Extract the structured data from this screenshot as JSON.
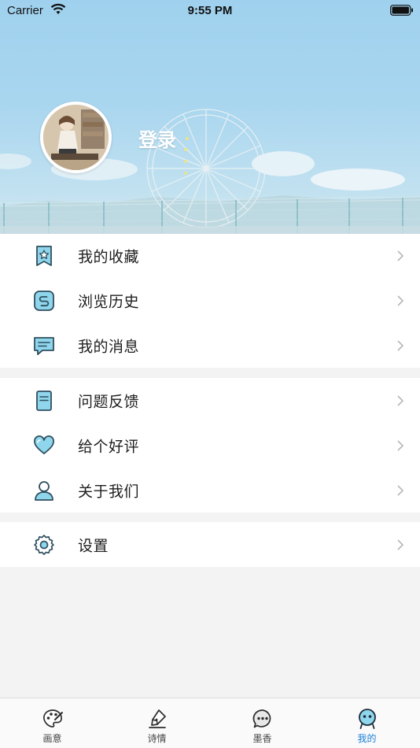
{
  "status_bar": {
    "carrier": "Carrier",
    "time": "9:55 PM"
  },
  "profile": {
    "login_label": "登录"
  },
  "menu_groups": [
    {
      "items": [
        {
          "label": "我的收藏",
          "icon": "bookmark-star-icon"
        },
        {
          "label": "浏览历史",
          "icon": "history-icon"
        },
        {
          "label": "我的消息",
          "icon": "message-icon"
        }
      ]
    },
    {
      "items": [
        {
          "label": "问题反馈",
          "icon": "feedback-icon"
        },
        {
          "label": "给个好评",
          "icon": "heart-icon"
        },
        {
          "label": "关于我们",
          "icon": "person-icon"
        }
      ]
    },
    {
      "items": [
        {
          "label": "设置",
          "icon": "gear-icon"
        }
      ]
    }
  ],
  "tabbar": {
    "active": "我的",
    "tabs": [
      {
        "label": "画意",
        "icon": "palette-icon"
      },
      {
        "label": "诗情",
        "icon": "pen-icon"
      },
      {
        "label": "墨香",
        "icon": "chat-bubble-icon"
      },
      {
        "label": "我的",
        "icon": "profile-face-icon"
      }
    ]
  },
  "colors": {
    "accent": "#1a7fd6",
    "icon_fill": "#8fd6ec",
    "icon_stroke": "#2f4f5f",
    "page_background": "#f3f3f3"
  }
}
